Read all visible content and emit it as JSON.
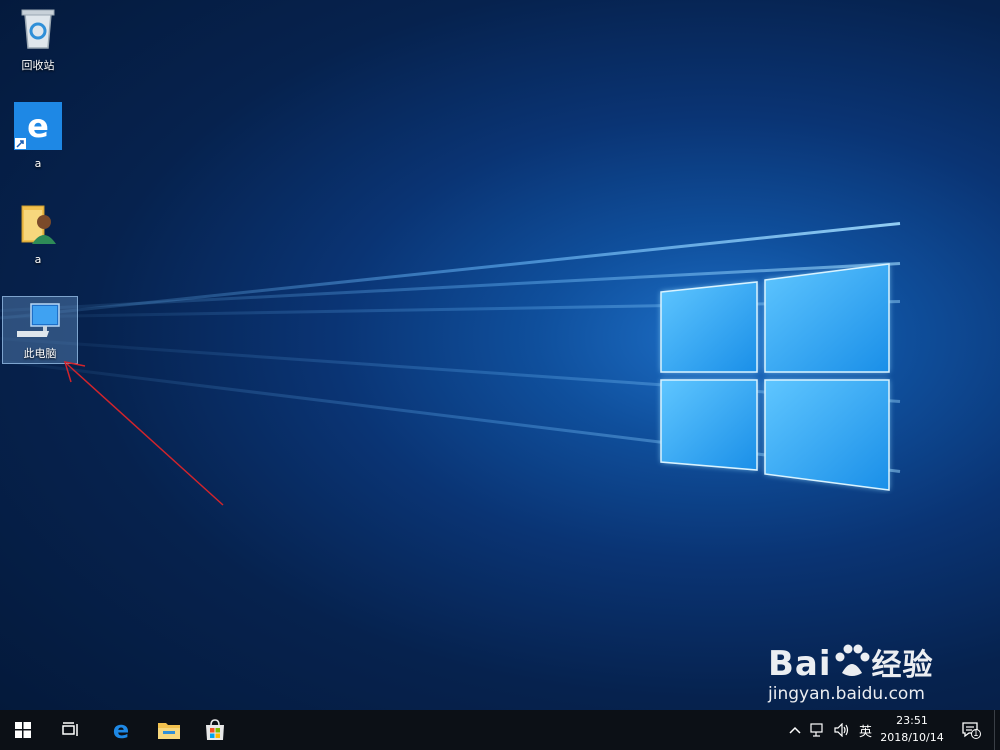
{
  "desktop_icons": {
    "recycle_bin": "回收站",
    "edge_shortcut": "a",
    "user_folder": "a",
    "this_pc": "此电脑"
  },
  "taskbar": {
    "tray_ime": "英",
    "clock_time": "23:51",
    "clock_date": "2018/10/14",
    "notification_count": "1"
  },
  "watermark": {
    "brand_prefix": "Bai",
    "brand_suffix": "经验",
    "url": "jingyan.baidu.com"
  },
  "colors": {
    "annotation_arrow": "#d2242b",
    "taskbar": "#0c1016",
    "edge_blue": "#1e88e5",
    "folder_yellow": "#f2c14e"
  }
}
